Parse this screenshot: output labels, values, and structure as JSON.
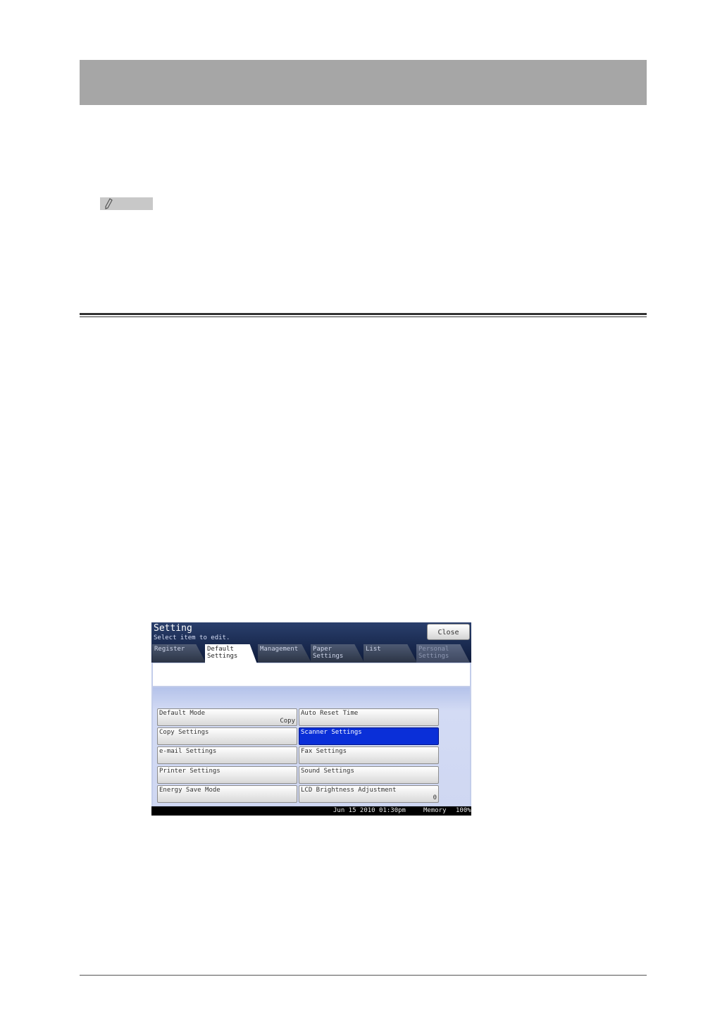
{
  "lcd": {
    "title": "Setting",
    "subtitle": "Select item to edit.",
    "close_label": "Close",
    "tabs": [
      {
        "label": "Register"
      },
      {
        "label": "Default\nSettings"
      },
      {
        "label": "Management"
      },
      {
        "label": "Paper\nSettings"
      },
      {
        "label": "List"
      },
      {
        "label": "Personal\nSettings"
      }
    ],
    "active_tab": "Default\nSettings",
    "buttons": [
      {
        "label": "Default Mode",
        "value": "Copy"
      },
      {
        "label": "Auto Reset Time",
        "value": ""
      },
      {
        "label": "Copy Settings",
        "value": ""
      },
      {
        "label": "Scanner Settings",
        "value": ""
      },
      {
        "label": "e-mail Settings",
        "value": ""
      },
      {
        "label": "Fax Settings",
        "value": ""
      },
      {
        "label": "Printer Settings",
        "value": ""
      },
      {
        "label": "Sound Settings",
        "value": ""
      },
      {
        "label": "Energy Save Mode",
        "value": ""
      },
      {
        "label": "LCD Brightness Adjustment",
        "value": "0"
      }
    ],
    "selected_button": "Scanner Settings",
    "status": {
      "datetime": "Jun 15 2010 01:30pm",
      "memory_label": "Memory",
      "memory_value": "100%"
    }
  },
  "colors": {
    "header_bar": "#a6a6a6",
    "selected_button": "#0a2fd8",
    "lcd_title_bg": "#1a2a52"
  }
}
